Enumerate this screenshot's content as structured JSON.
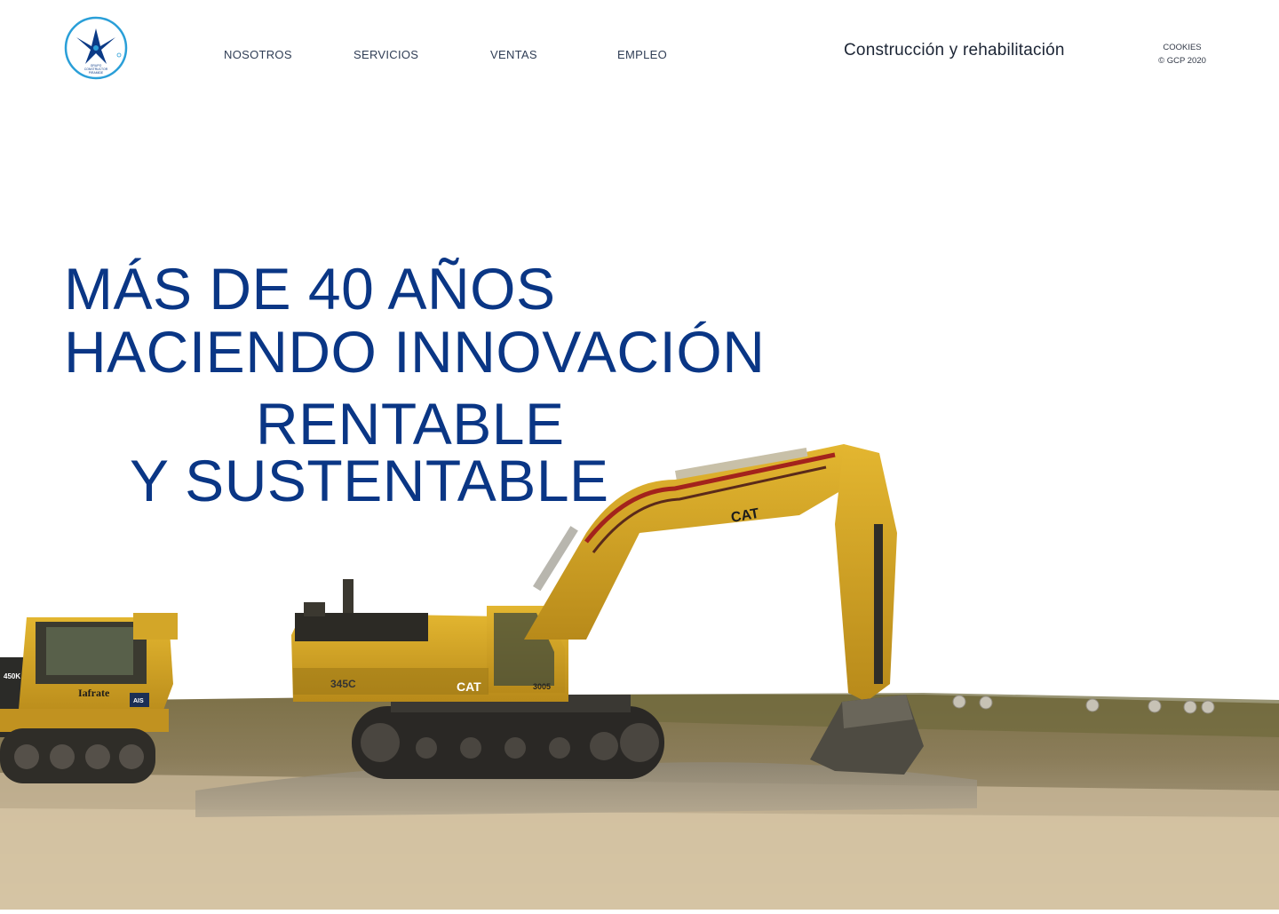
{
  "brand": {
    "logo_text_lines": [
      "GRUPO",
      "CONSTRUCTOR",
      "PIRAMIDE"
    ],
    "accent_color": "#2a9fd8",
    "primary_color": "#0a3685"
  },
  "nav": {
    "items": [
      {
        "label": "NOSOTROS"
      },
      {
        "label": "SERVICIOS"
      },
      {
        "label": "VENTAS"
      },
      {
        "label": "EMPLEO"
      }
    ]
  },
  "header": {
    "tagline": "Construcción y rehabilitación",
    "cookies_link": "COOKIES",
    "copyright": "© GCP 2020"
  },
  "hero": {
    "line1": "MÁS DE 40 AÑOS",
    "line2": "HACIENDO INNOVACIÓN",
    "line3": "RENTABLE",
    "line4": "Y SUSTENTABLE"
  },
  "photo": {
    "excavator_brand": "CAT",
    "excavator_model": "345C",
    "excavator_number": "3005",
    "dozer_label": "Iafrate",
    "dozer_model": "450K",
    "dozer_badge": "AIS"
  }
}
